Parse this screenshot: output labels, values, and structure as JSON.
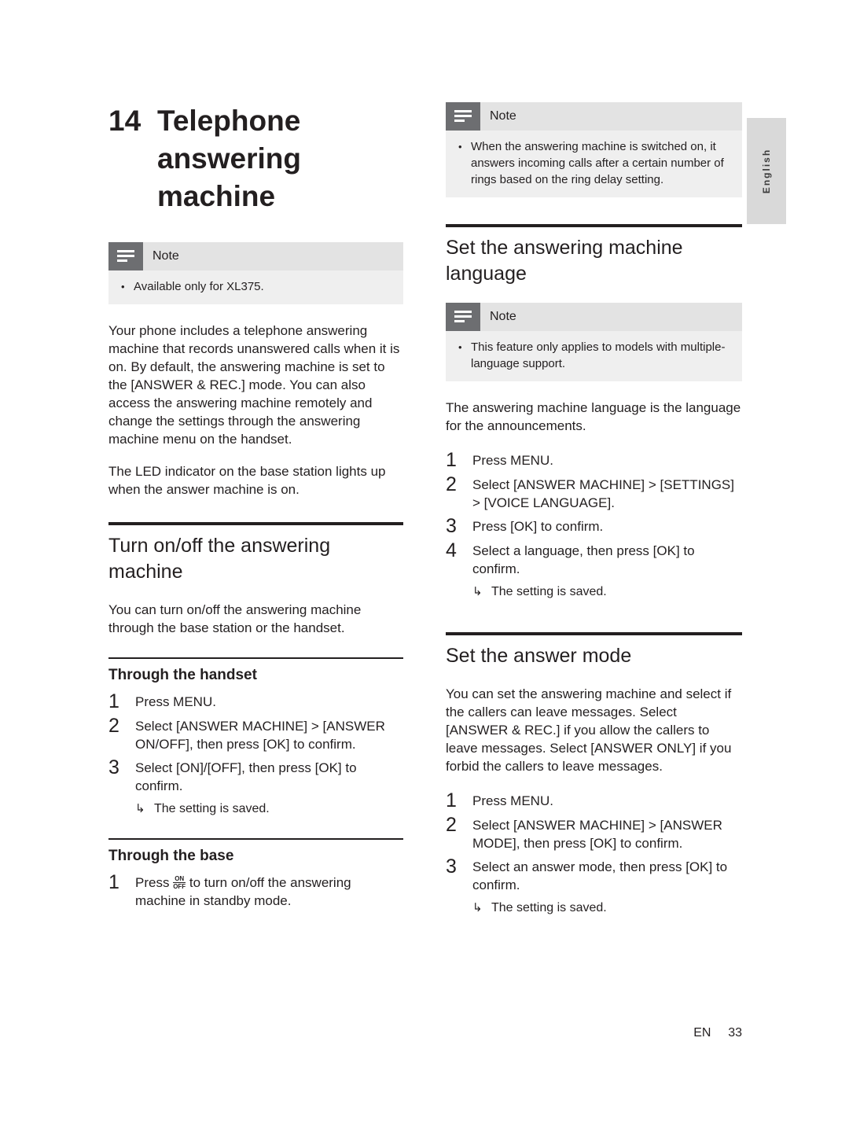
{
  "page": {
    "side_tab_label": "English",
    "footer": {
      "lang": "EN",
      "page_number": "33"
    }
  },
  "chapter": {
    "number": "14",
    "title": "Telephone answering machine"
  },
  "notes": {
    "label": "Note",
    "left_note_text": "Available only for XL375.",
    "right_note_top_text": "When the answering machine is switched on, it answers incoming calls after a certain number of rings based on the ring delay setting.",
    "right_note_language_text": "This feature only applies to models with multiple-language support."
  },
  "left_column": {
    "intro_p1": "Your phone includes a telephone answering machine that records unanswered calls when it is on. By default, the answering machine is set to the [ANSWER & REC.] mode. You can also access the answering machine remotely and change the settings through the answering machine menu on the handset.",
    "intro_p2": "The LED indicator on the base station lights up when the answer machine is on.",
    "section_turn_onoff": "Turn on/off the answering machine",
    "turn_onoff_intro": "You can turn on/off the answering machine through the base station or the handset.",
    "sub_through_handset": "Through the handset",
    "handset_steps": [
      {
        "num": "1",
        "text": "Press MENU."
      },
      {
        "num": "2",
        "text": "Select [ANSWER MACHINE] > [ANSWER ON/OFF], then press [OK] to confirm."
      },
      {
        "num": "3",
        "text": "Select [ON]/[OFF], then press [OK] to confirm."
      }
    ],
    "handset_result": "The setting is saved.",
    "sub_through_base": "Through the base",
    "base_step_num": "1",
    "base_step_prefix": "Press ",
    "base_step_suffix": " to turn on/off the answering machine in standby mode.",
    "base_icon_on": "ON",
    "base_icon_off": "OFF"
  },
  "right_column": {
    "section_language": "Set the answering machine language",
    "language_intro": "The answering machine language is the language for the announcements.",
    "language_steps": [
      {
        "num": "1",
        "text": "Press MENU."
      },
      {
        "num": "2",
        "text": "Select [ANSWER MACHINE] > [SETTINGS] > [VOICE LANGUAGE]."
      },
      {
        "num": "3",
        "text": "Press [OK] to confirm."
      },
      {
        "num": "4",
        "text": "Select a language, then press [OK] to confirm."
      }
    ],
    "language_result": "The setting is saved.",
    "section_answer_mode": "Set the answer mode",
    "answer_mode_intro": "You can set the answering machine and select if the callers can leave messages. Select [ANSWER & REC.] if you allow the callers to leave messages. Select [ANSWER ONLY] if you forbid the callers to leave messages.",
    "answer_mode_steps": [
      {
        "num": "1",
        "text": "Press MENU."
      },
      {
        "num": "2",
        "text": "Select [ANSWER MACHINE] > [ANSWER MODE], then press [OK] to confirm."
      },
      {
        "num": "3",
        "text": "Select an answer mode, then press [OK] to confirm."
      }
    ],
    "answer_mode_result": "The setting is saved.",
    "arrow": "↳",
    "bullet": "•"
  }
}
